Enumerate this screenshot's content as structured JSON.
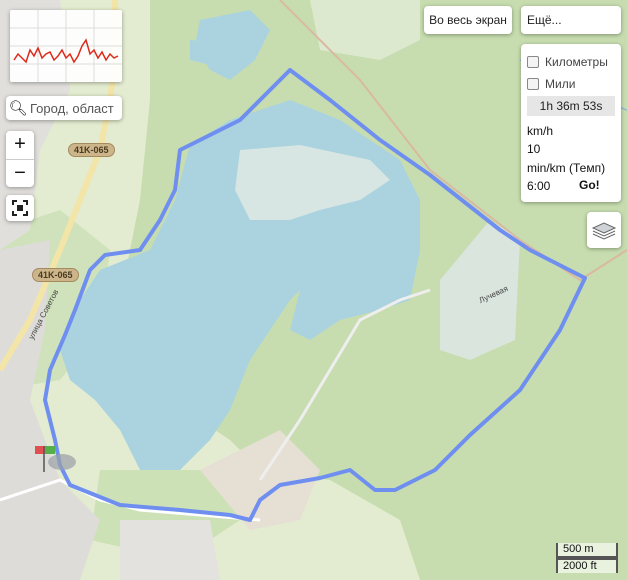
{
  "controls": {
    "fullscreen_label": "Во весь экран",
    "more_label": "Ещё...",
    "search_placeholder": "Город, област",
    "zoom_in": "+",
    "zoom_out": "−"
  },
  "panel": {
    "km_label": "Километры",
    "miles_label": "Мили",
    "duration": "1h 36m 53s",
    "speed_unit": "km/h",
    "speed_value": "10",
    "pace_unit": "min/km (Темп)",
    "pace_value": "6:00",
    "go_label": "Go!"
  },
  "map_labels": {
    "road_1": "41K-065",
    "road_2": "41K-065",
    "street_1": "улица Советов",
    "street_2": "Лучевая"
  },
  "scale": {
    "metric": "500 m",
    "imperial": "2000 ft"
  },
  "colors": {
    "water": "#aad3df",
    "forest": "#c8dfb0",
    "route": "#6f8ff0",
    "route_outline": "#5a72d8"
  }
}
